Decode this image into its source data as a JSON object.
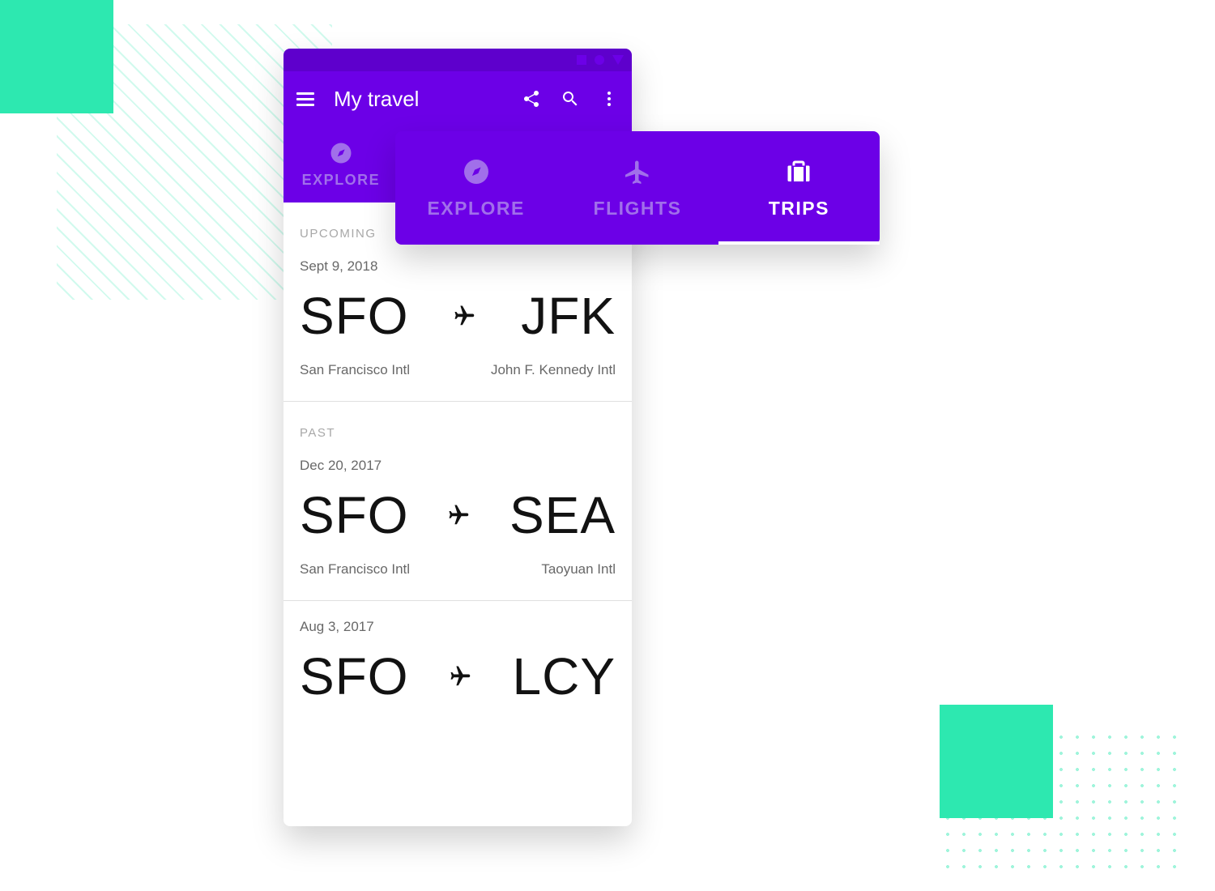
{
  "colors": {
    "accent": "#6C00E7",
    "accentDark": "#5E00CC",
    "mint": "#2DE8B0"
  },
  "app": {
    "title": "My travel",
    "actions": {
      "menu": "menu",
      "share": "share",
      "search": "search",
      "more": "more"
    },
    "localTabs": [
      {
        "id": "explore",
        "label": "EXPLORE",
        "icon": "compass",
        "active": false
      }
    ]
  },
  "floatingTabs": [
    {
      "id": "explore",
      "label": "EXPLORE",
      "icon": "compass",
      "active": false
    },
    {
      "id": "flights",
      "label": "FLIGHTS",
      "icon": "airplane",
      "active": false
    },
    {
      "id": "trips",
      "label": "TRIPS",
      "icon": "suitcase",
      "active": true
    }
  ],
  "sections": [
    {
      "id": "upcoming",
      "label": "UPCOMING",
      "trips": [
        {
          "date": "Sept 9, 2018",
          "from": {
            "code": "SFO",
            "name": "San Francisco Intl"
          },
          "to": {
            "code": "JFK",
            "name": "John F. Kennedy Intl"
          }
        }
      ]
    },
    {
      "id": "past",
      "label": "PAST",
      "trips": [
        {
          "date": "Dec 20, 2017",
          "from": {
            "code": "SFO",
            "name": "San Francisco Intl"
          },
          "to": {
            "code": "SEA",
            "name": "Taoyuan Intl"
          }
        },
        {
          "date": "Aug 3, 2017",
          "from": {
            "code": "SFO",
            "name": ""
          },
          "to": {
            "code": "LCY",
            "name": ""
          }
        }
      ]
    }
  ]
}
